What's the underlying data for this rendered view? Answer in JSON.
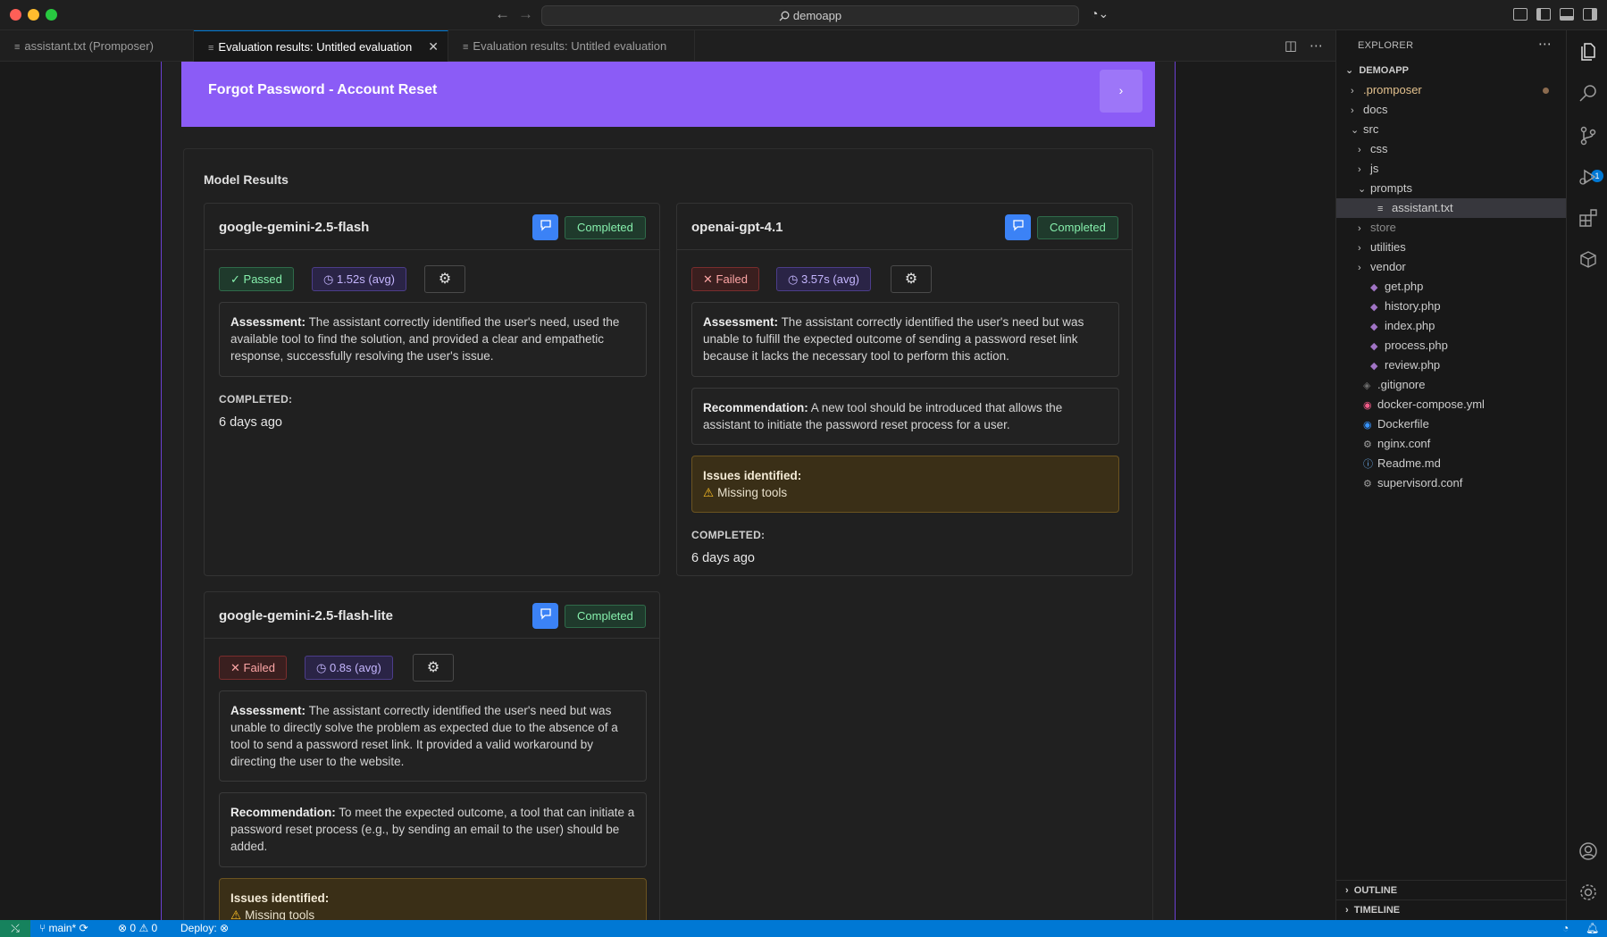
{
  "window": {
    "command_center": "demoapp"
  },
  "tabs": [
    {
      "label": "assistant.txt (Promposer)",
      "active": false
    },
    {
      "label": "Evaluation results: Untitled evaluation",
      "active": true
    },
    {
      "label": "Evaluation results: Untitled evaluation",
      "active": false
    }
  ],
  "evaluation": {
    "header_title": "Forgot Password - Account Reset",
    "header_button": "›",
    "section_title": "Model Results",
    "completed_label": "COMPLETED:",
    "results": [
      {
        "model": "google-gemini-2.5-flash",
        "status": "Completed",
        "verdict": "Passed",
        "verdict_icon": "✓",
        "time": "1.52s (avg)",
        "assessment_label": "Assessment:",
        "assessment": "The assistant correctly identified the user's need, used the available tool to find the solution, and provided a clear and empathetic response, successfully resolving the user's issue.",
        "completed": "6 days ago"
      },
      {
        "model": "openai-gpt-4.1",
        "status": "Completed",
        "verdict": "Failed",
        "verdict_icon": "✕",
        "time": "3.57s (avg)",
        "assessment_label": "Assessment:",
        "assessment": "The assistant correctly identified the user's need but was unable to fulfill the expected outcome of sending a password reset link because it lacks the necessary tool to perform this action.",
        "recommendation_label": "Recommendation:",
        "recommendation": "A new tool should be introduced that allows the assistant to initiate the password reset process for a user.",
        "issues_label": "Issues identified:",
        "issues": "Missing tools",
        "completed": "6 days ago"
      },
      {
        "model": "google-gemini-2.5-flash-lite",
        "status": "Completed",
        "verdict": "Failed",
        "verdict_icon": "✕",
        "time": "0.8s (avg)",
        "assessment_label": "Assessment:",
        "assessment": "The assistant correctly identified the user's need but was unable to directly solve the problem as expected due to the absence of a tool to send a password reset link. It provided a valid workaround by directing the user to the website.",
        "recommendation_label": "Recommendation:",
        "recommendation": "To meet the expected outcome, a tool that can initiate a password reset process (e.g., by sending an email to the user) should be added.",
        "issues_label": "Issues identified:",
        "issues": "Missing tools"
      }
    ]
  },
  "explorer": {
    "title": "EXPLORER",
    "root": "DEMOAPP",
    "items": [
      {
        "label": ".promposer",
        "indent": 1,
        "chev": "›",
        "icon": "",
        "color": "#e2c08d"
      },
      {
        "label": "docs",
        "indent": 1,
        "chev": "›",
        "icon": ""
      },
      {
        "label": "src",
        "indent": 1,
        "chev": "⌄",
        "icon": ""
      },
      {
        "label": "css",
        "indent": 2,
        "chev": "›",
        "icon": ""
      },
      {
        "label": "js",
        "indent": 2,
        "chev": "›",
        "icon": ""
      },
      {
        "label": "prompts",
        "indent": 2,
        "chev": "⌄",
        "icon": ""
      },
      {
        "label": "assistant.txt",
        "indent": 3,
        "chev": "",
        "icon": "≡",
        "selected": true
      },
      {
        "label": "store",
        "indent": 2,
        "chev": "›",
        "icon": "",
        "color": "#8b8b8b"
      },
      {
        "label": "utilities",
        "indent": 2,
        "chev": "›",
        "icon": ""
      },
      {
        "label": "vendor",
        "indent": 2,
        "chev": "›",
        "icon": ""
      },
      {
        "label": "get.php",
        "indent": 2,
        "chev": "",
        "icon": "php"
      },
      {
        "label": "history.php",
        "indent": 2,
        "chev": "",
        "icon": "php"
      },
      {
        "label": "index.php",
        "indent": 2,
        "chev": "",
        "icon": "php"
      },
      {
        "label": "process.php",
        "indent": 2,
        "chev": "",
        "icon": "php"
      },
      {
        "label": "review.php",
        "indent": 2,
        "chev": "",
        "icon": "php"
      },
      {
        "label": ".gitignore",
        "indent": 1,
        "chev": "",
        "icon": "git"
      },
      {
        "label": "docker-compose.yml",
        "indent": 1,
        "chev": "",
        "icon": "yml"
      },
      {
        "label": "Dockerfile",
        "indent": 1,
        "chev": "",
        "icon": "docker"
      },
      {
        "label": "nginx.conf",
        "indent": 1,
        "chev": "",
        "icon": "gear"
      },
      {
        "label": "Readme.md",
        "indent": 1,
        "chev": "",
        "icon": "info"
      },
      {
        "label": "supervisord.conf",
        "indent": 1,
        "chev": "",
        "icon": "gear"
      }
    ],
    "outline": "OUTLINE",
    "timeline": "TIMELINE"
  },
  "activity": {
    "scm_count": "1"
  },
  "statusbar": {
    "branch": "main*",
    "errors": "0",
    "warnings": "0",
    "deploy": "Deploy:"
  }
}
